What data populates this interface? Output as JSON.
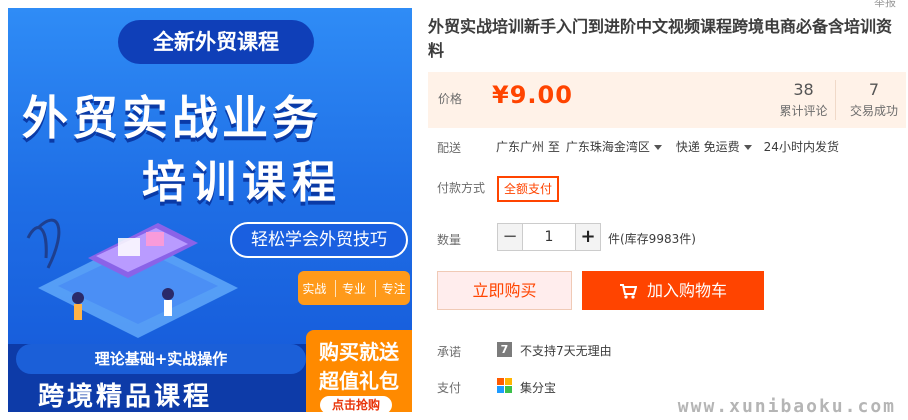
{
  "image_banner": {
    "top": "全新外贸课程",
    "title_line1": "外贸实战业务",
    "title_line2": "培训课程",
    "pill": "轻松学会外贸技巧",
    "tags": [
      "实战",
      "专业",
      "专注"
    ],
    "bottom_line1": "理论基础+实战操作",
    "bottom_line2": "跨境精品课程",
    "gift_line1": "购买就送",
    "gift_line2": "超值礼包",
    "gift_cta": "点击抢购"
  },
  "crumb_text": "举报",
  "product": {
    "title": "外贸实战培训新手入门到进阶中文视频课程跨境电商必备含培训资料"
  },
  "price": {
    "label": "价格",
    "value": "¥9.00",
    "reviews_count": "38",
    "reviews_label": "累计评论",
    "deals_count": "7",
    "deals_label": "交易成功"
  },
  "delivery": {
    "label": "配送",
    "from": "广东广州 至",
    "to": "广东珠海金湾区",
    "method": "快递 免运费",
    "time": "24小时内发货"
  },
  "payment": {
    "label": "付款方式",
    "option": "全额支付"
  },
  "quantity": {
    "label": "数量",
    "minus": "−",
    "value": "1",
    "plus": "+",
    "stock": "件(库存9983件)"
  },
  "actions": {
    "buy_now": "立即购买",
    "add_to_cart": "加入购物车"
  },
  "promise": {
    "label": "承诺",
    "icon_text": "7",
    "text": "不支持7天无理由"
  },
  "pay_service": {
    "label": "支付",
    "text": "集分宝"
  },
  "watermark": "www.xunibaoku.com",
  "colors": {
    "accent": "#ff4400",
    "price_bg": "#fff2e8",
    "image_blue": "#1f6fe6",
    "gift_orange": "#ff8a00"
  },
  "icons": {
    "cart": "cart-icon",
    "promise": "seven-day-icon",
    "pay": "jifenbao-icon"
  }
}
